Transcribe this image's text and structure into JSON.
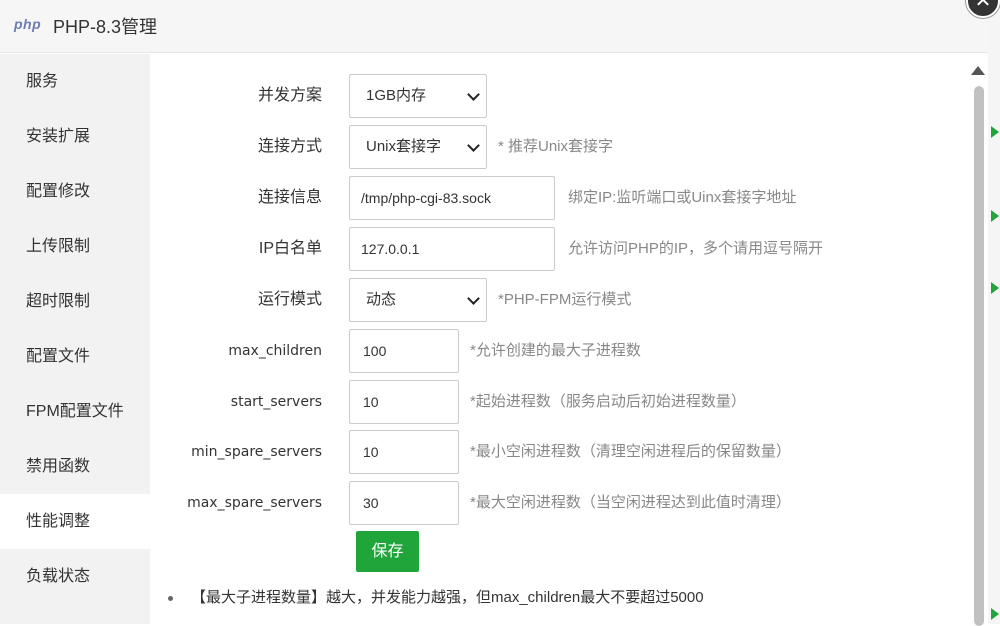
{
  "window": {
    "logo": "php",
    "title": "PHP-8.3管理",
    "close_symbol": "✕"
  },
  "sidebar": {
    "items": [
      {
        "label": "服务"
      },
      {
        "label": "安装扩展"
      },
      {
        "label": "配置修改"
      },
      {
        "label": "上传限制"
      },
      {
        "label": "超时限制"
      },
      {
        "label": "配置文件"
      },
      {
        "label": "FPM配置文件"
      },
      {
        "label": "禁用函数"
      },
      {
        "label": "性能调整"
      },
      {
        "label": "负载状态"
      }
    ],
    "active": "性能调整"
  },
  "form": {
    "concurrency": {
      "label": "并发方案",
      "value": "1GB内存"
    },
    "connection_mode": {
      "label": "连接方式",
      "value": "Unix套接字",
      "hint": "* 推荐Unix套接字"
    },
    "connection_info": {
      "label": "连接信息",
      "value": "/tmp/php-cgi-83.sock",
      "hint": "绑定IP:监听端口或Uinx套接字地址"
    },
    "ip_whitelist": {
      "label": "IP白名单",
      "value": "127.0.0.1",
      "hint": "允许访问PHP的IP，多个请用逗号隔开"
    },
    "run_mode": {
      "label": "运行模式",
      "value": "动态",
      "hint": "*PHP-FPM运行模式"
    },
    "max_children": {
      "label": "max_children",
      "value": "100",
      "hint": "*允许创建的最大子进程数"
    },
    "start_servers": {
      "label": "start_servers",
      "value": "10",
      "hint": "*起始进程数（服务启动后初始进程数量）"
    },
    "min_spare_servers": {
      "label": "min_spare_servers",
      "value": "10",
      "hint": "*最小空闲进程数（清理空闲进程后的保留数量）"
    },
    "max_spare_servers": {
      "label": "max_spare_servers",
      "value": "30",
      "hint": "*最大空闲进程数（当空闲进程达到此值时清理）"
    },
    "save_label": "保存"
  },
  "notes": [
    "【最大子进程数量】越大，并发能力越强，但max_children最大不要超过5000"
  ],
  "colors": {
    "accent": "#20a53a",
    "sidebar_bg": "#f2f2f2",
    "hint": "#888888"
  }
}
